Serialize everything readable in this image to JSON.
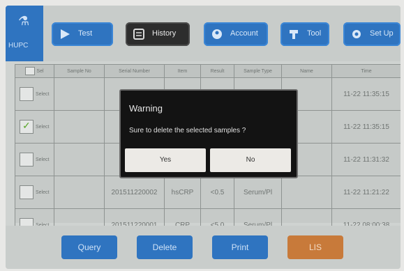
{
  "app": {
    "logo_text": "HUPC"
  },
  "toolbar": {
    "test_label": "Test",
    "history_label": "History",
    "account_label": "Account",
    "tool_label": "Tool",
    "setup_label": "Set Up"
  },
  "table": {
    "headers": [
      "Sel",
      "Sample No",
      "Serial Number",
      "Item",
      "Result",
      "Sample Type",
      "Name",
      "Time"
    ],
    "select_label": "Select",
    "rows": [
      {
        "checked": false,
        "sample_no": "",
        "serial": "201",
        "item": "",
        "result": "",
        "type": "",
        "name": "",
        "time": "11-22 11:35:15"
      },
      {
        "checked": true,
        "sample_no": "",
        "serial": "201",
        "item": "",
        "result": "",
        "type": "",
        "name": "",
        "time": "11-22 11:35:15"
      },
      {
        "checked": false,
        "sample_no": "",
        "serial": "201",
        "item": "",
        "result": "",
        "type": "",
        "name": "",
        "time": "11-22 11:31:32"
      },
      {
        "checked": false,
        "sample_no": "",
        "serial": "201511220002",
        "item": "hsCRP",
        "result": "<0.5",
        "type": "Serum/Pl",
        "name": "",
        "time": "11-22 11:21:22"
      },
      {
        "checked": false,
        "sample_no": "",
        "serial": "201511220001",
        "item": "CRP",
        "result": "<5.0",
        "type": "Serum/Pl",
        "name": "",
        "time": "11-22 08:00:38"
      }
    ]
  },
  "bottom": {
    "query_label": "Query",
    "delete_label": "Delete",
    "print_label": "Print",
    "lis_label": "LIS"
  },
  "dialog": {
    "title": "Warning",
    "message": "Sure to delete the selected samples ?",
    "yes_label": "Yes",
    "no_label": "No"
  },
  "colors": {
    "accent_blue": "#2f74c0",
    "active_dark": "#2d2d2d",
    "lis_orange": "#c87a3a",
    "dialog_bg": "#131313",
    "check_green": "#5aa62a"
  }
}
